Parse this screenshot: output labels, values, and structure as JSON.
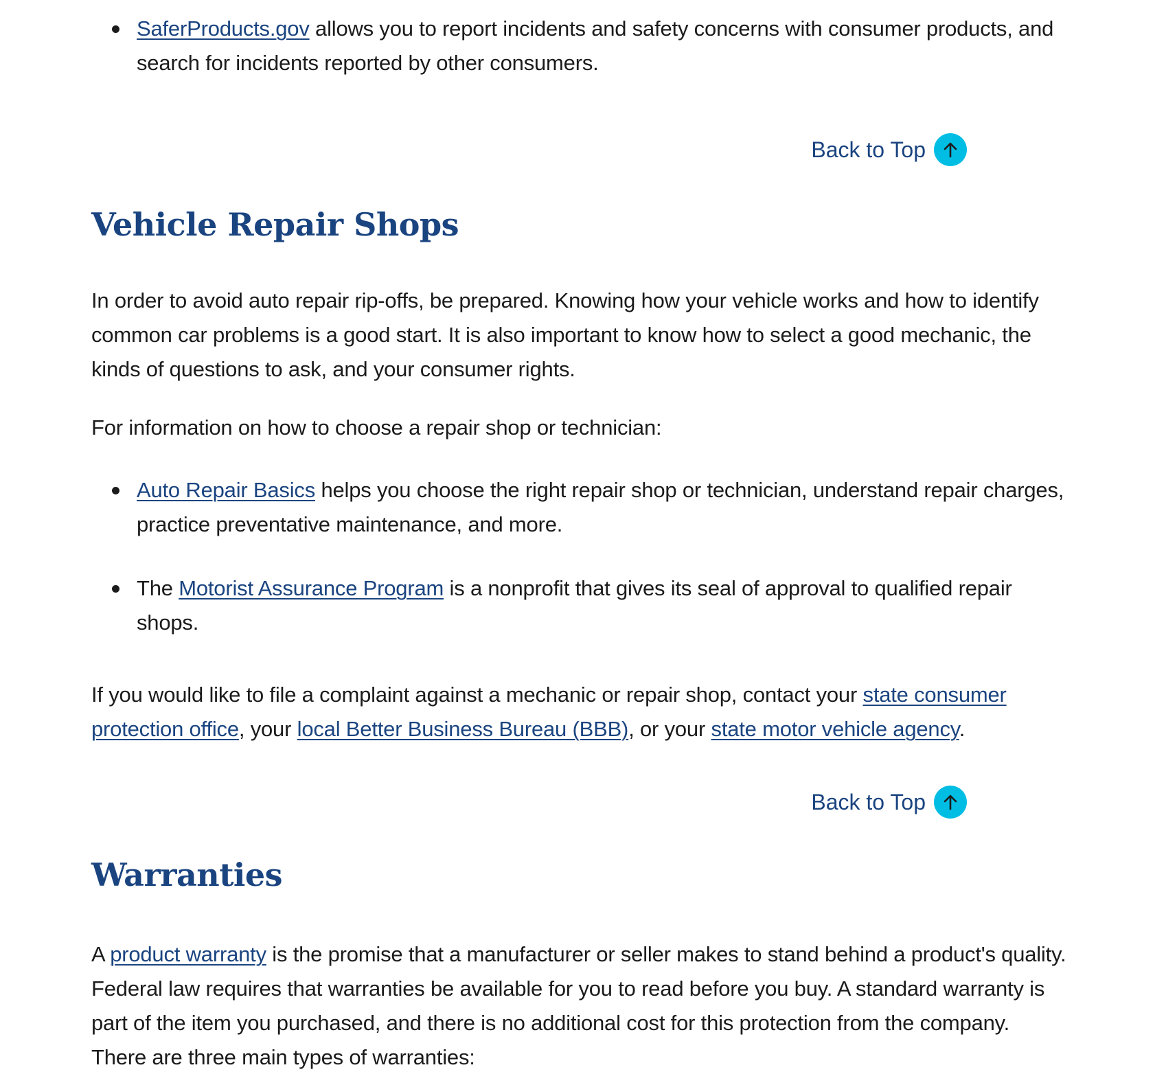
{
  "top_list": {
    "item1": {
      "link": "SaferProducts.gov",
      "text": " allows you to report incidents and safety concerns with consumer products, and search for incidents reported by other consumers."
    }
  },
  "back_to_top": {
    "label": "Back to Top",
    "icon": "arrow-up-icon",
    "icon_color": "#00bde3"
  },
  "vehicle_section": {
    "title": "Vehicle Repair Shops",
    "intro": "In order to avoid auto repair rip-offs, be prepared. Knowing how your vehicle works and how to identify common car problems is a good start. It is also important to know how to select a good mechanic, the kinds of questions to ask, and your consumer rights.",
    "lead": "For information on how to choose a repair shop or technician:",
    "items": [
      {
        "prefix": "",
        "link": "Auto Repair Basics",
        "text": " helps you choose the right repair shop or technician, understand repair charges, practice preventative maintenance, and more."
      },
      {
        "prefix": "The ",
        "link": "Motorist Assurance Program",
        "text": " is a nonprofit that gives its seal of approval to qualified repair shops."
      }
    ],
    "complaint": {
      "text1": "If you would like to file a complaint against a mechanic or repair shop, contact your ",
      "link1": "state consumer protection office",
      "text2": ", your ",
      "link2": "local Better Business Bureau (BBB)",
      "text3": ", or your ",
      "link3": "state motor vehicle agency",
      "text4": "."
    }
  },
  "warranties_section": {
    "title": "Warranties",
    "prefix": "A ",
    "link": "product warranty",
    "text": " is the promise that a manufacturer or seller makes to stand behind a product's quality. Federal law requires that warranties be available for you to read before you buy. A standard warranty is part of the item you purchased, and there is no additional cost for this protection from the company. There are three main types of warranties:"
  },
  "colors": {
    "heading": "#1a4480",
    "link": "#1a4480",
    "body_text": "#1b1b1b"
  }
}
